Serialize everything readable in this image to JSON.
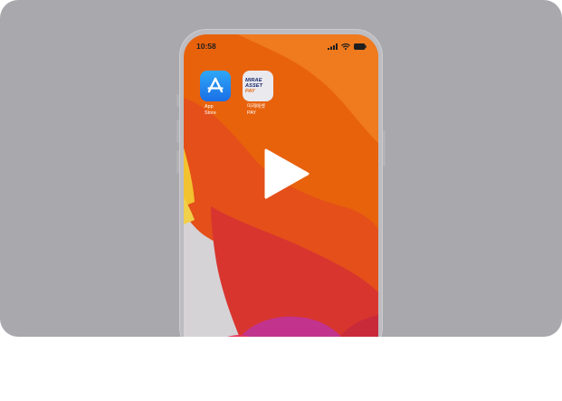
{
  "status_bar": {
    "time": "10:58"
  },
  "apps": [
    {
      "label_line1": "App",
      "label_line2": "Store",
      "icon": "app-store-icon"
    },
    {
      "label_line1": "미래에셋",
      "label_line2": "PAY",
      "icon": "mirae-asset-pay-icon",
      "icon_text": {
        "line1": "MIRAE",
        "line2": "ASSET",
        "line3": "PAY"
      }
    }
  ],
  "overlay": {
    "play_icon": "play-icon"
  },
  "colors": {
    "card_background": "#a9a8ad",
    "wallpaper_orange": "#e8620c",
    "wallpaper_red": "#d8352f",
    "play_button": "#ffffff"
  }
}
